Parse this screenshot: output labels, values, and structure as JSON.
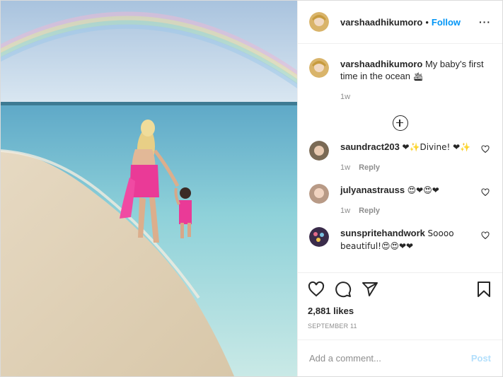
{
  "post": {
    "author": "varshaadhikumoro",
    "separator": "•",
    "follow_label": "Follow",
    "more_label": "···"
  },
  "caption": {
    "username": "varshaadhikumoro",
    "text": "My baby's first time in the ocean",
    "emoji": "🛳",
    "time": "1w"
  },
  "comments": [
    {
      "username": "saundract203",
      "text": "❤✨Divine! ❤✨",
      "time": "1w",
      "reply_label": "Reply",
      "avatar_color": "#7a6a55"
    },
    {
      "username": "julyanastrauss",
      "text": "😍❤😍❤",
      "time": "1w",
      "reply_label": "Reply",
      "avatar_color": "#b89a86"
    },
    {
      "username": "sunspritehandwork",
      "text": "Soooo beautiful!😍😍❤❤",
      "time": "",
      "reply_label": "",
      "avatar_color": "#3a2b4a"
    }
  ],
  "likes": "2,881 likes",
  "date": "SEPTEMBER 11",
  "add_comment": {
    "placeholder": "Add a comment...",
    "post_label": "Post"
  },
  "icons": [
    "heart-icon",
    "comment-icon",
    "share-icon",
    "bookmark-icon",
    "plus-circle-icon"
  ]
}
